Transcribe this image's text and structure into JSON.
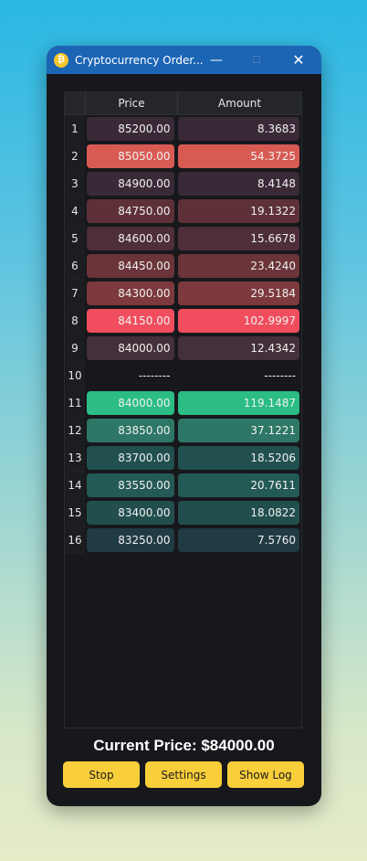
{
  "window": {
    "title": "Cryptocurrency Order...",
    "icon": "bitcoin-icon",
    "controls": {
      "minimize": "—",
      "maximize": "☐",
      "close": "✕"
    }
  },
  "table": {
    "headers": {
      "price": "Price",
      "amount": "Amount"
    },
    "rows": [
      {
        "n": "1",
        "price": "85200.00",
        "amount": "8.3683",
        "color": "#3a2a37"
      },
      {
        "n": "2",
        "price": "85050.00",
        "amount": "54.3725",
        "color": "#d85b53"
      },
      {
        "n": "3",
        "price": "84900.00",
        "amount": "8.4148",
        "color": "#3a2a37"
      },
      {
        "n": "4",
        "price": "84750.00",
        "amount": "19.1322",
        "color": "#5e3139"
      },
      {
        "n": "5",
        "price": "84600.00",
        "amount": "15.6678",
        "color": "#4d2e39"
      },
      {
        "n": "6",
        "price": "84450.00",
        "amount": "23.4240",
        "color": "#6a3438"
      },
      {
        "n": "7",
        "price": "84300.00",
        "amount": "29.5184",
        "color": "#7c3a3e"
      },
      {
        "n": "8",
        "price": "84150.00",
        "amount": "102.9997",
        "color": "#f04e5e"
      },
      {
        "n": "9",
        "price": "84000.00",
        "amount": "12.4342",
        "color": "#44303a"
      },
      {
        "n": "10",
        "price": "--------",
        "amount": "--------",
        "color": ""
      },
      {
        "n": "11",
        "price": "84000.00",
        "amount": "119.1487",
        "color": "#2bbd84"
      },
      {
        "n": "12",
        "price": "83850.00",
        "amount": "37.1221",
        "color": "#2e7766"
      },
      {
        "n": "13",
        "price": "83700.00",
        "amount": "18.5206",
        "color": "#21504f"
      },
      {
        "n": "14",
        "price": "83550.00",
        "amount": "20.7611",
        "color": "#245a55"
      },
      {
        "n": "15",
        "price": "83400.00",
        "amount": "18.0822",
        "color": "#224f4e"
      },
      {
        "n": "16",
        "price": "83250.00",
        "amount": "7.5760",
        "color": "#213b44"
      }
    ]
  },
  "current_price": "Current Price: $84000.00",
  "buttons": {
    "stop": "Stop",
    "settings": "Settings",
    "show_log": "Show Log"
  }
}
